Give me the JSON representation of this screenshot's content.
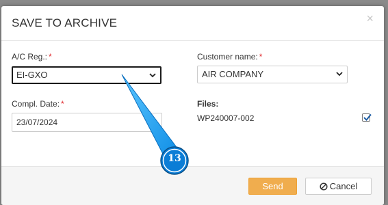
{
  "dialog": {
    "title": "SAVE TO ARCHIVE",
    "close_glyph": "×"
  },
  "form": {
    "ac_reg": {
      "label": "A/C Reg.:",
      "required_mark": "*",
      "value": "EI-GXO"
    },
    "customer": {
      "label": "Customer name:",
      "required_mark": "*",
      "value": "AIR COMPANY"
    },
    "compl_date": {
      "label": "Compl. Date:",
      "required_mark": "*",
      "value": "23/07/2024"
    },
    "files": {
      "label": "Files:",
      "items": [
        {
          "name": "WP240007-002",
          "checked": true
        }
      ]
    }
  },
  "footer": {
    "send_label": "Send",
    "cancel_label": "Cancel"
  },
  "annotation": {
    "step_number": "13"
  },
  "colors": {
    "send_button": "#f0ad4e",
    "required": "#e0262a",
    "annotation_fill": "#1da1f2",
    "annotation_badge": "#0b7dd6"
  }
}
